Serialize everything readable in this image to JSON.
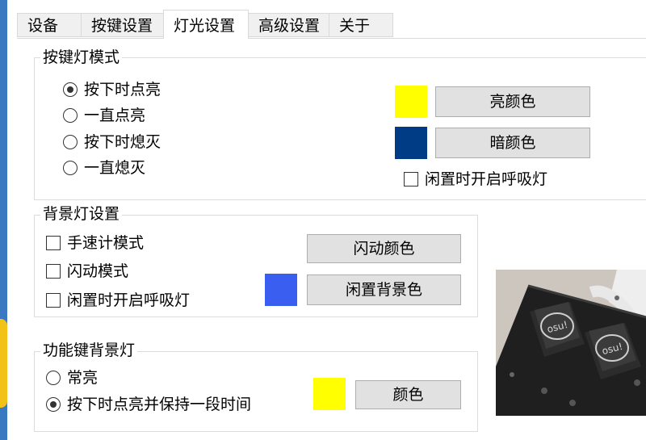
{
  "tabs": [
    {
      "label": "设备"
    },
    {
      "label": "按键设置"
    },
    {
      "label": "灯光设置"
    },
    {
      "label": "高级设置"
    },
    {
      "label": "关于"
    }
  ],
  "key_light": {
    "title": "按键灯模式",
    "options": [
      "按下时点亮",
      "一直点亮",
      "按下时熄灭",
      "一直熄灭"
    ],
    "selected_index": 0,
    "bright_color_label": "亮颜色",
    "dark_color_label": "暗颜色",
    "bright_color": "#ffff00",
    "dark_color": "#003c86",
    "idle_breathing_label": "闲置时开启呼吸灯"
  },
  "backlight": {
    "title": "背景灯设置",
    "checks": [
      "手速计模式",
      "闪动模式",
      "闲置时开启呼吸灯"
    ],
    "flash_color_label": "闪动颜色",
    "idle_bg_color_label": "闲置背景色",
    "idle_bg_color": "#3a5ff0"
  },
  "function_key": {
    "title": "功能键背景灯",
    "options": [
      "常亮",
      "按下时点亮并保持一段时间"
    ],
    "selected_index": 1,
    "color_label": "颜色",
    "color": "#ffff00"
  },
  "device_photo": {
    "key_caps": [
      "osu!",
      "osu!"
    ]
  }
}
